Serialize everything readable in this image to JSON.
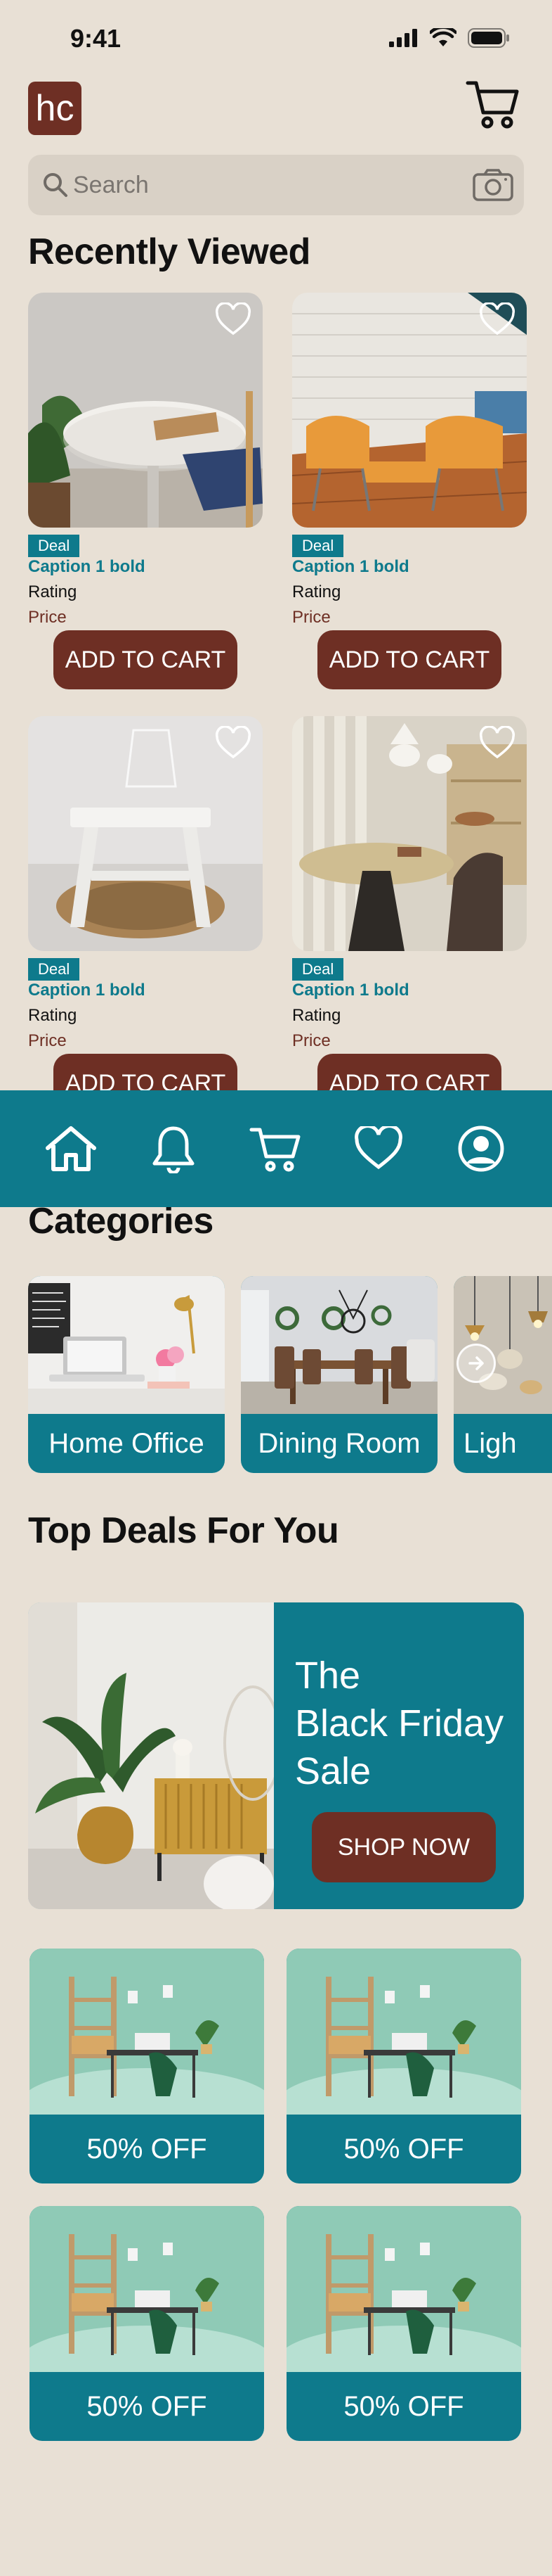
{
  "status": {
    "time": "9:41"
  },
  "header": {
    "logo_text": "hc",
    "cart_icon": "cart-icon"
  },
  "search": {
    "placeholder": "Search",
    "value": ""
  },
  "recently_viewed": {
    "title": "Recently Viewed",
    "products": [
      {
        "badge": "Deal",
        "caption": "Caption 1 bold",
        "rating": "Rating",
        "price": "Price",
        "button": "ADD TO CART"
      },
      {
        "badge": "Deal",
        "caption": "Caption 1 bold",
        "rating": "Rating",
        "price": "Price",
        "button": "ADD TO CART"
      },
      {
        "badge": "Deal",
        "caption": "Caption 1 bold",
        "rating": "Rating",
        "price": "Price",
        "button": "ADD TO CART"
      },
      {
        "badge": "Deal",
        "caption": "Caption 1 bold",
        "rating": "Rating",
        "price": "Price",
        "button": "ADD TO CART"
      }
    ]
  },
  "tabbar": {
    "tabs": [
      "home-icon",
      "bell-icon",
      "cart-icon",
      "heart-icon",
      "profile-icon"
    ]
  },
  "categories": {
    "title": "Categories",
    "items": [
      "Home Office",
      "Dining Room",
      "Ligh"
    ]
  },
  "top_deals": {
    "title": "Top Deals For You",
    "banner": {
      "line1": "The",
      "line2": "Black Friday",
      "line3": "Sale",
      "button": "SHOP NOW"
    },
    "deals": [
      "50% OFF",
      "50% OFF",
      "50% OFF",
      "50% OFF"
    ]
  },
  "colors": {
    "background": "#e8e0d5",
    "accent": "#0e7a8c",
    "brand": "#6e2f24"
  }
}
